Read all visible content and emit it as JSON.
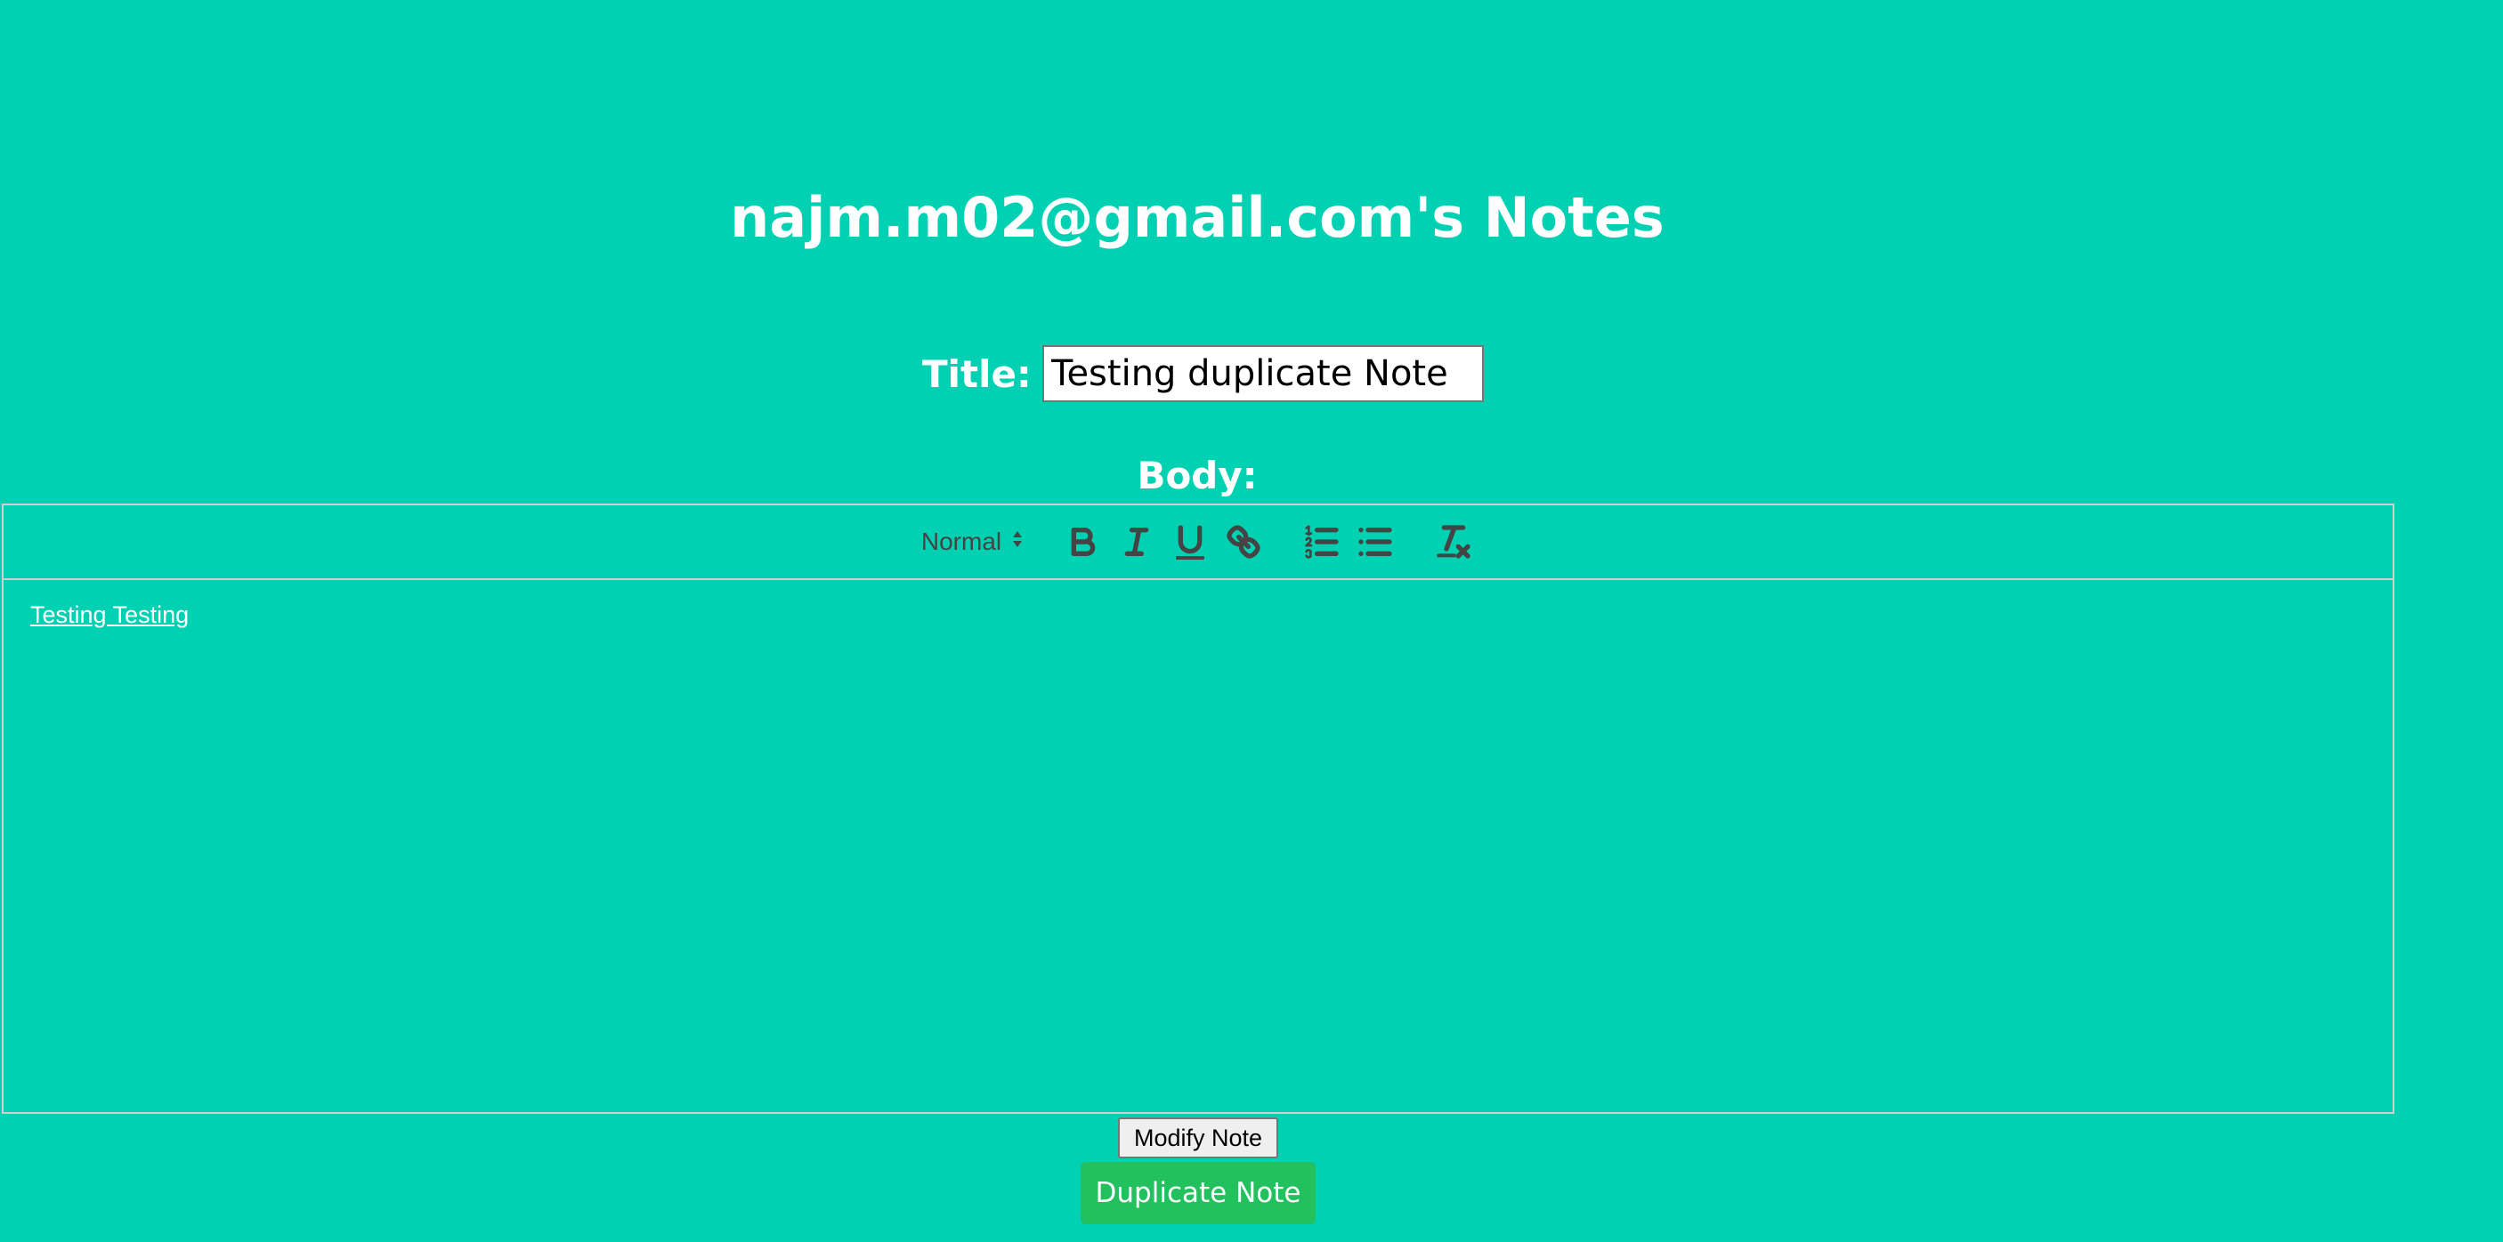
{
  "page": {
    "title": "najm.m02@gmail.com's Notes"
  },
  "form": {
    "title_label": "Title:",
    "title_value": "Testing duplicate Note",
    "body_label": "Body:"
  },
  "editor": {
    "toolbar": {
      "header_select": "Normal",
      "buttons": [
        "bold-icon",
        "italic-icon",
        "underline-icon",
        "link-icon",
        "ordered-list-icon",
        "bullet-list-icon",
        "clear-format-icon"
      ]
    },
    "content": "Testing Testing"
  },
  "actions": {
    "modify_label": "Modify Note",
    "duplicate_label": "Duplicate Note"
  },
  "colors": {
    "background": "#00d1b2",
    "duplicate_button": "#23c05e"
  }
}
